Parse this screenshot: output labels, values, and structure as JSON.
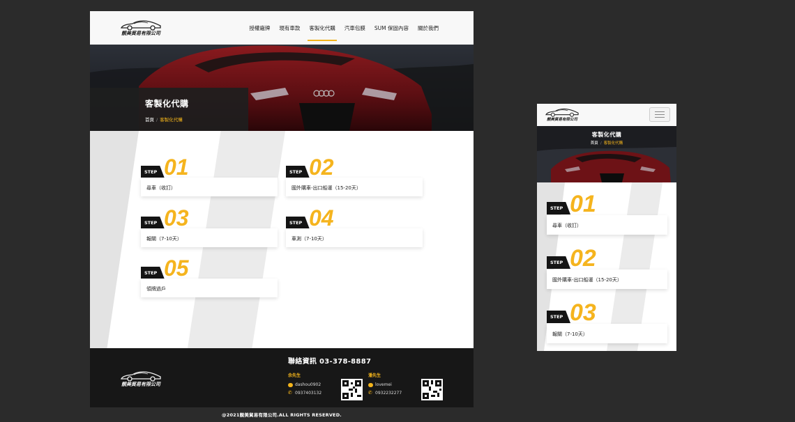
{
  "brand": {
    "logo_text": "靚美貿易有限公司"
  },
  "nav": [
    {
      "label": "授權廠牌"
    },
    {
      "label": "現有車款"
    },
    {
      "label": "客製化代購",
      "active": true
    },
    {
      "label": "汽車包膜"
    },
    {
      "label": "SUM 保固內容"
    },
    {
      "label": "關於我們"
    }
  ],
  "hero": {
    "title": "客製化代購",
    "breadcrumb_home": "首頁",
    "breadcrumb_sep": "/",
    "breadcrumb_current": "客製化代購"
  },
  "steps": [
    {
      "tag": "STEP",
      "num": "01",
      "text": "尋車（收訂）"
    },
    {
      "tag": "STEP",
      "num": "02",
      "text": "國外購車-出口船運（15-20天）"
    },
    {
      "tag": "STEP",
      "num": "03",
      "text": "報關（7-10天）"
    },
    {
      "tag": "STEP",
      "num": "04",
      "text": "車測（7-10天）"
    },
    {
      "tag": "STEP",
      "num": "05",
      "text": "領牌過戶"
    }
  ],
  "footer": {
    "contact_title": "聯絡資訊 03-378-8887",
    "contacts": [
      {
        "name": "余先生",
        "line": "dashou0902",
        "phone": "0937403132"
      },
      {
        "name": "潘先生",
        "line": "lovemei",
        "phone": "0932232277"
      }
    ],
    "copyright": "@2021靚美貿易有限公司.ALL RIGHTS RESERVED."
  },
  "colors": {
    "accent": "#f3b41b",
    "dark": "#171717",
    "background": "#2b2b2b"
  },
  "icons": {
    "menu": "hamburger-menu-icon",
    "line": "line-chat-icon",
    "phone": "phone-icon",
    "logo": "sports-car-icon"
  }
}
